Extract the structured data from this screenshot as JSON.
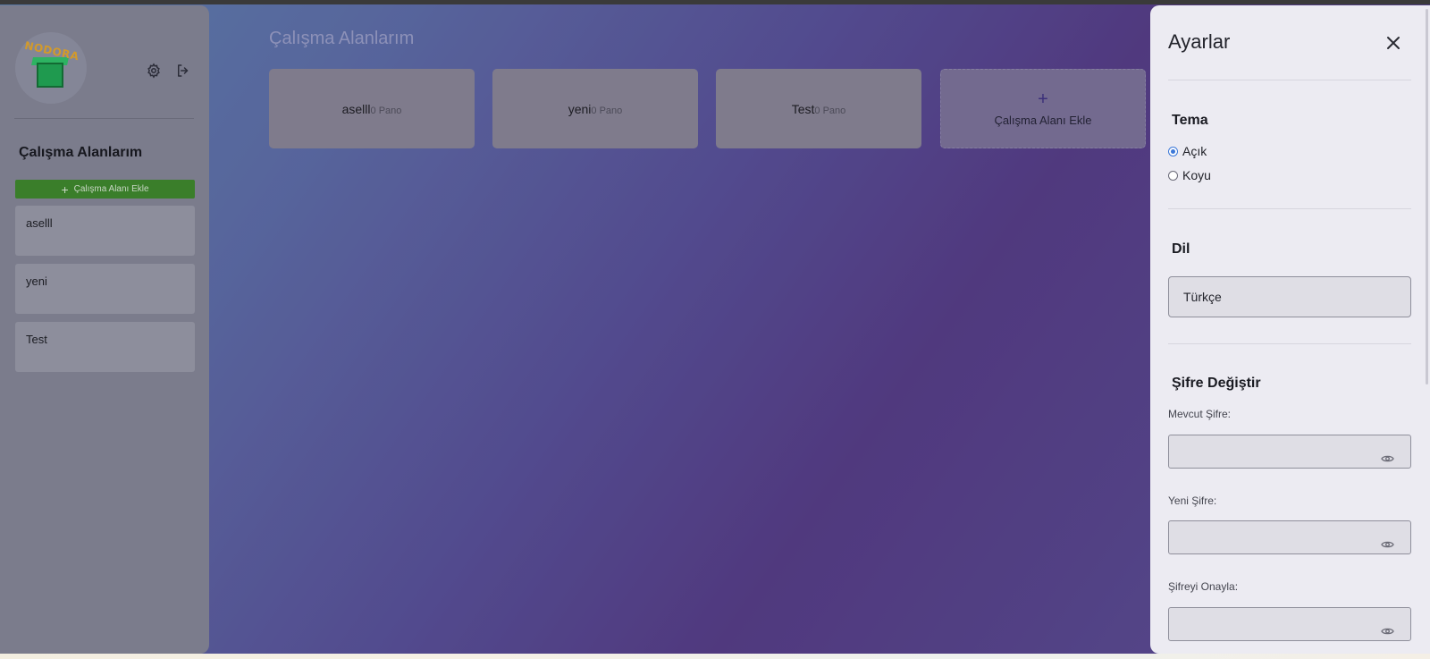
{
  "app": {
    "logo_text": "NODORA"
  },
  "sidebar": {
    "title": "Çalışma Alanlarım",
    "add_button_label": "Çalışma Alanı Ekle",
    "items": [
      {
        "label": "aselll"
      },
      {
        "label": "yeni"
      },
      {
        "label": "Test"
      }
    ]
  },
  "main": {
    "title": "Çalışma Alanlarım",
    "workspaces": [
      {
        "name": "aselll",
        "count": "0 Pano"
      },
      {
        "name": "yeni",
        "count": "0 Pano"
      },
      {
        "name": "Test",
        "count": "0 Pano"
      }
    ],
    "add_card_label": "Çalışma Alanı Ekle",
    "add_card_icon": "+"
  },
  "settings": {
    "title": "Ayarlar",
    "theme": {
      "title": "Tema",
      "options": [
        {
          "label": "Açık",
          "selected": true
        },
        {
          "label": "Koyu",
          "selected": false
        }
      ]
    },
    "language": {
      "title": "Dil",
      "value": "Türkçe"
    },
    "password": {
      "title": "Şifre Değiştir",
      "current_label": "Mevcut Şifre:",
      "new_label": "Yeni Şifre:",
      "confirm_label": "Şifreyi Onayla:",
      "current_value": "",
      "new_value": "",
      "confirm_value": ""
    }
  },
  "colors": {
    "accent": "#3c78d8",
    "add_button": "#3a7e2a"
  }
}
